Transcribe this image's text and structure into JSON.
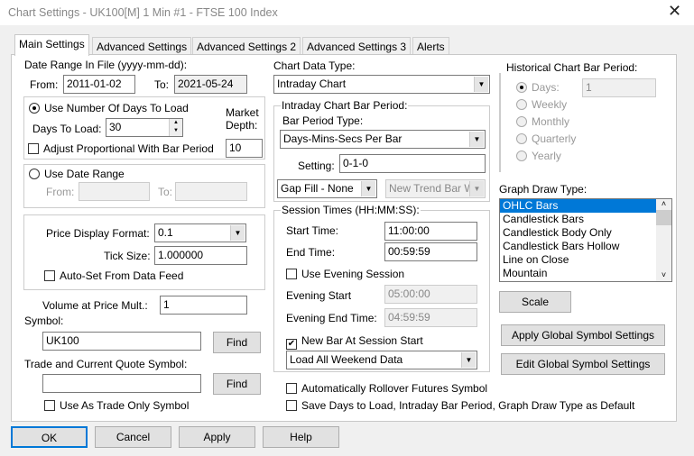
{
  "window": {
    "title": "Chart Settings - UK100[M]  1 Min  #1 - FTSE 100 Index",
    "close": "✕"
  },
  "tabs": [
    "Main Settings",
    "Advanced Settings",
    "Advanced Settings 2",
    "Advanced Settings 3",
    "Alerts"
  ],
  "left": {
    "date_range_label": "Date Range In File (yyyy-mm-dd):",
    "from_label": "From:",
    "from": "2011-01-02",
    "to_label": "To:",
    "to": "2021-05-24",
    "use_days_label": "Use Number Of Days To Load",
    "days_label": "Days To Load:",
    "days": "30",
    "market_depth_label": "Market Depth:",
    "market_depth": "10",
    "adjust_label": "Adjust Proportional With Bar Period",
    "use_date_range_label": "Use Date Range",
    "dr_from_label": "From:",
    "dr_to_label": "To:",
    "price_format_label": "Price Display Format:",
    "price_format": "0.1",
    "tick_size_label": "Tick Size:",
    "tick_size": "1.000000",
    "auto_set_label": "Auto-Set From Data Feed",
    "volume_mult_label": "Volume at Price Mult.:",
    "volume_mult": "1",
    "symbol_label": "Symbol:",
    "symbol": "UK100",
    "find": "Find",
    "trade_symbol_label": "Trade and Current Quote Symbol:",
    "trade_symbol": "",
    "trade_only_label": "Use As Trade Only Symbol"
  },
  "middle": {
    "chart_data_type_label": "Chart Data Type:",
    "chart_data_type": "Intraday Chart",
    "intraday_group": "Intraday Chart Bar Period:",
    "bar_period_type_label": "Bar Period Type:",
    "bar_period_type": "Days-Mins-Secs Per Bar",
    "setting_label": "Setting:",
    "setting": "0-1-0",
    "gap_fill": "Gap Fill - None",
    "new_trend": "New Trend Bar W",
    "session_group": "Session Times (HH:MM:SS):",
    "start_label": "Start Time:",
    "start": "11:00:00",
    "end_label": "End Time:",
    "end": "00:59:59",
    "evening_label": "Use Evening Session",
    "evening_start_label": "Evening Start",
    "evening_start": "05:00:00",
    "evening_end_label": "Evening End Time:",
    "evening_end": "04:59:59",
    "new_bar_label": "New Bar At Session Start",
    "weekend": "Load All Weekend Data",
    "rollover_label": "Automatically Rollover Futures Symbol",
    "save_default_label": "Save Days to Load, Intraday Bar Period, Graph Draw Type as Default"
  },
  "right": {
    "hist_group": "Historical Chart Bar Period:",
    "days_label": "Days:",
    "days": "1",
    "weekly": "Weekly",
    "monthly": "Monthly",
    "quarterly": "Quarterly",
    "yearly": "Yearly",
    "graph_label": "Graph Draw Type:",
    "graph_items": [
      "OHLC Bars",
      "Candlestick Bars",
      "Candlestick Body Only",
      "Candlestick Bars Hollow",
      "Line on Close",
      "Mountain"
    ],
    "scale": "Scale",
    "apply_global": "Apply Global Symbol Settings",
    "edit_global": "Edit Global Symbol Settings"
  },
  "buttons": {
    "ok": "OK",
    "cancel": "Cancel",
    "apply": "Apply",
    "help": "Help"
  }
}
